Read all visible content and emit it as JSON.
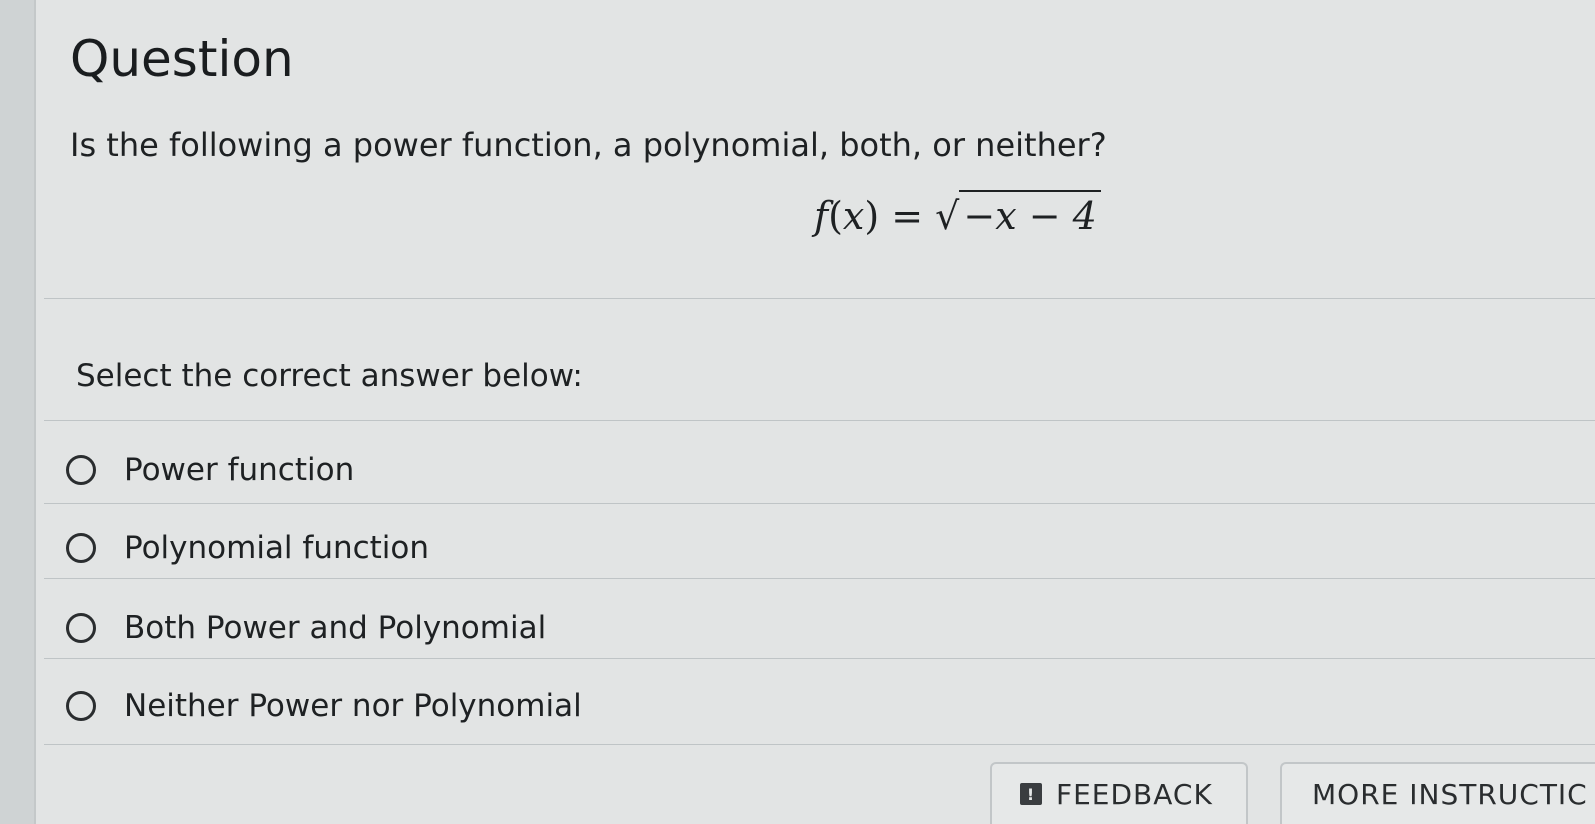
{
  "question": {
    "title": "Question",
    "prompt": "Is the following a power function, a polynomial, both, or neither?",
    "formula": {
      "lhs_f": "f",
      "lhs_open": "(",
      "lhs_x": "x",
      "lhs_close": ")",
      "equals": " = ",
      "radical_sign": "√",
      "radicand": "−x − 4"
    }
  },
  "answers": {
    "instruction": "Select the correct answer below:",
    "options": [
      {
        "label": "Power function",
        "selected": false
      },
      {
        "label": "Polynomial function",
        "selected": false
      },
      {
        "label": "Both Power and Polynomial",
        "selected": false
      },
      {
        "label": "Neither Power nor Polynomial",
        "selected": false
      }
    ]
  },
  "footer": {
    "feedback_icon": "!",
    "feedback_label": "FEEDBACK",
    "more_label": "MORE INSTRUCTIC"
  },
  "icons": {
    "feedback": "exclamation-icon",
    "radio": "radio-unchecked-icon"
  }
}
